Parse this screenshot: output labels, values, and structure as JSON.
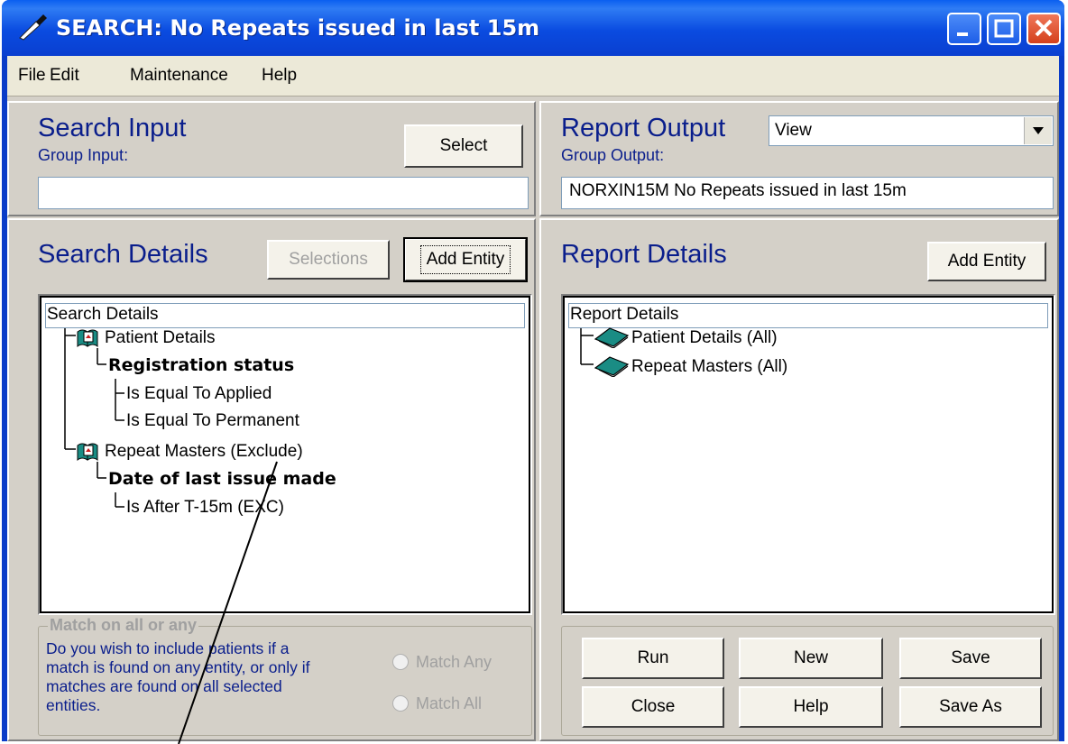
{
  "window": {
    "title": "SEARCH: No Repeats issued in last 15m"
  },
  "menu": {
    "file": "File",
    "edit": "Edit",
    "maintenance": "Maintenance",
    "help": "Help"
  },
  "search_input": {
    "heading": "Search Input",
    "group_label": "Group Input:",
    "select_button": "Select",
    "group_value": ""
  },
  "report_output": {
    "heading": "Report Output",
    "mode_selected": "View",
    "group_label": "Group Output:",
    "group_value": "NORXIN15M No Repeats issued in last 15m"
  },
  "search_details": {
    "heading": "Search Details",
    "selections_button": "Selections",
    "add_entity_button": "Add Entity",
    "tree": {
      "root": "Search Details",
      "patient_details": "Patient Details",
      "registration_status": "Registration status",
      "is_equal_applied": "Is Equal To Applied",
      "is_equal_permanent": "Is Equal To Permanent",
      "repeat_masters": "Repeat Masters (Exclude)",
      "date_last_issue": "Date of last issue made",
      "is_after": "Is After T-15m (EXC)"
    }
  },
  "report_details": {
    "heading": "Report Details",
    "add_entity_button": "Add Entity",
    "tree": {
      "root": "Report Details",
      "patient_details_all": "Patient Details (All)",
      "repeat_masters_all": "Repeat Masters (All)"
    }
  },
  "match": {
    "legend": "Match on all or any",
    "description_1": "Do you wish to include patients if a",
    "description_2": "match is found on any entity, or only if",
    "description_3": "matches are found on all selected",
    "description_4": "entities.",
    "match_any": "Match Any",
    "match_all": "Match All"
  },
  "actions": {
    "run": "Run",
    "new": "New",
    "save": "Save",
    "close": "Close",
    "help": "Help",
    "save_as": "Save As"
  }
}
